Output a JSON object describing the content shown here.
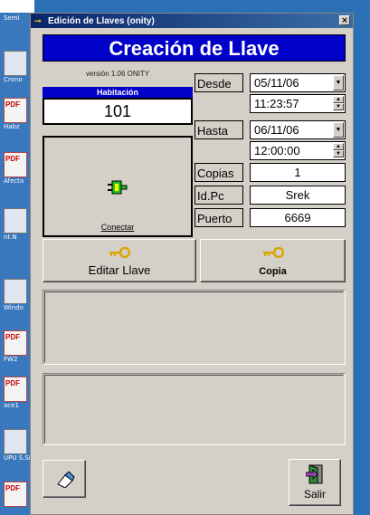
{
  "desktop": {
    "icons": [
      {
        "caption": "Semi",
        "kind": "plain"
      },
      {
        "caption": "Crono",
        "kind": "plain"
      },
      {
        "caption": "Habz",
        "kind": "pdf"
      },
      {
        "caption": "Afecta",
        "kind": "pdf"
      },
      {
        "caption": "nt.N",
        "kind": "plain"
      },
      {
        "caption": "Windo",
        "kind": "plain"
      },
      {
        "caption": "FW2",
        "kind": "pdf"
      },
      {
        "caption": "ace1",
        "kind": "pdf"
      },
      {
        "caption": "UPU S.SE",
        "kind": "plain"
      },
      {
        "caption": "",
        "kind": "pdf"
      }
    ]
  },
  "window": {
    "title": "Edición de Llaves (onity)",
    "close_label": "×"
  },
  "header": {
    "banner": "Creación de Llave",
    "version": "versión 1.06  ONITY"
  },
  "room": {
    "label": "Habitación",
    "value": "101"
  },
  "connect_button": {
    "label": "Conectar"
  },
  "fields": {
    "desde_label": "Desde",
    "desde_date": "05/11/06",
    "desde_time": "11:23:57",
    "hasta_label": "Hasta",
    "hasta_date": "06/11/06",
    "hasta_time": "12:00:00",
    "copias_label": "Copias",
    "copias_value": "1",
    "idpc_label": "Id.Pc",
    "idpc_value": "Srek",
    "puerto_label": "Puerto",
    "puerto_value": "6669"
  },
  "actions": {
    "edit_key": "Editar Llave",
    "copy": "Copia",
    "exit": "Salir"
  },
  "colors": {
    "banner_bg": "#0000c8",
    "window_bg": "#d4d0c8",
    "titlebar": "#0a246a"
  }
}
